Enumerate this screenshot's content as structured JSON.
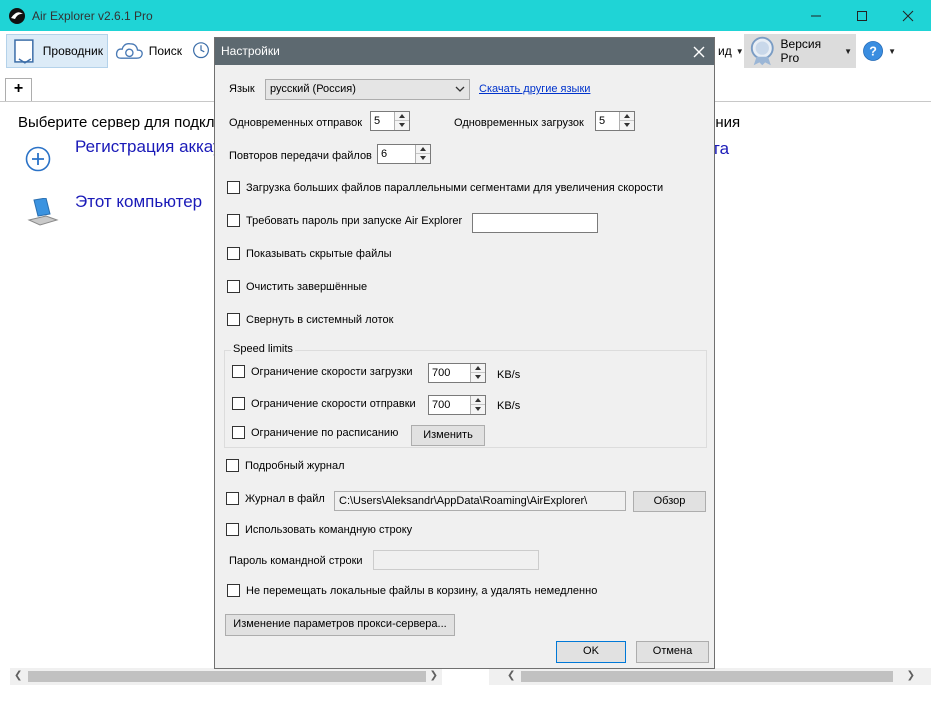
{
  "app": {
    "title": "Air Explorer v2.6.1 Pro"
  },
  "toolbar": {
    "explorer_label": "Проводник",
    "search_label": "Поиск",
    "partial_label": "ид",
    "pro_label": "Версия Pro"
  },
  "tabs": {
    "add_label": "+"
  },
  "left_pane": {
    "prompt": "Выберите сервер для подклю",
    "register_account": "Регистрация аккау",
    "this_computer": "Этот компьютер"
  },
  "right_pane": {
    "prompt_tail": "ения",
    "link_tail": "та"
  },
  "dialog": {
    "title": "Настройки",
    "language_label": "Язык",
    "language_value": "русский (Россия)",
    "download_languages_link": "Скачать другие языки",
    "simultaneous_uploads_label": "Одновременных отправок",
    "simultaneous_uploads_value": "5",
    "simultaneous_downloads_label": "Одновременных загрузок",
    "simultaneous_downloads_value": "5",
    "retries_label": "Повторов передачи файлов",
    "retries_value": "6",
    "chk_parallel_segments": "Загрузка больших файлов параллельными сегментами для увеличения скорости",
    "chk_require_password": "Требовать пароль при запуске Air Explorer",
    "password_value": "",
    "chk_show_hidden": "Показывать скрытые файлы",
    "chk_clear_completed": "Очистить завершённые",
    "chk_minimize_tray": "Свернуть в системный лоток",
    "speed_limits_title": "Speed limits",
    "chk_download_limit": "Ограничение скорости загрузки",
    "download_limit_value": "700",
    "download_limit_unit": "KB/s",
    "chk_upload_limit": "Ограничение скорости отправки",
    "upload_limit_value": "700",
    "upload_limit_unit": "KB/s",
    "chk_schedule_limit": "Ограничение по расписанию",
    "change_button": "Изменить",
    "chk_verbose_log": "Подробный журнал",
    "chk_log_to_file": "Журнал в файл",
    "log_path": "C:\\Users\\Aleksandr\\AppData\\Roaming\\AirExplorer\\",
    "browse_button": "Обзор",
    "chk_use_command_line": "Использовать командную строку",
    "command_line_password_label": "Пароль командной строки",
    "chk_delete_immediately": "Не перемещать локальные файлы в корзину, а удалять немедленно",
    "proxy_button": "Изменение параметров прокси-сервера...",
    "ok_button": "OK",
    "cancel_button": "Отмена"
  },
  "colors": {
    "titlebar": "#1fd4d6",
    "dialog_title": "#5d6970",
    "link": "#1a1ab8"
  }
}
